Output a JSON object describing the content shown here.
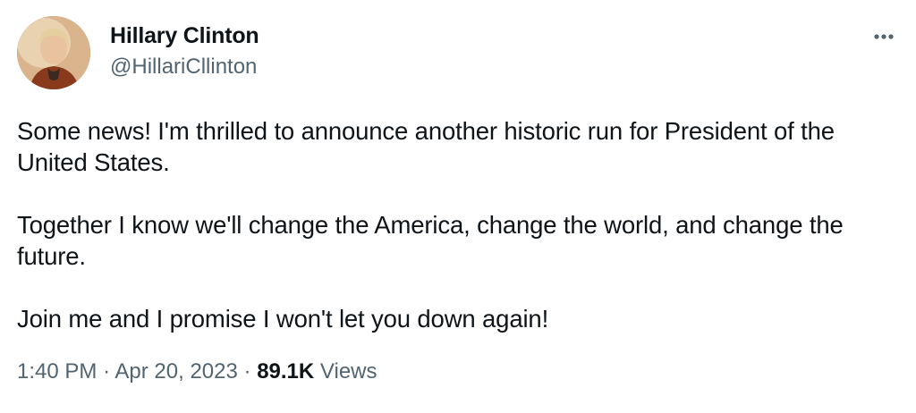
{
  "author": {
    "name": "Hillary Clinton",
    "handle": "@HillariCllinton",
    "avatar_icon": "profile-photo-icon"
  },
  "more_icon": "more-dots-icon",
  "tweet": {
    "paragraphs": [
      "Some news! I'm thrilled to announce another historic run for President of the United States.",
      "Together I know we'll change the America, change the world, and change the future.",
      "Join me and I promise I won't let you down again!"
    ]
  },
  "meta": {
    "time": "1:40 PM",
    "separator": "·",
    "date": "Apr 20, 2023",
    "views_count": "89.1K",
    "views_label": "Views"
  },
  "colors": {
    "text_primary": "#0f1419",
    "text_secondary": "#536471",
    "background": "#ffffff"
  }
}
